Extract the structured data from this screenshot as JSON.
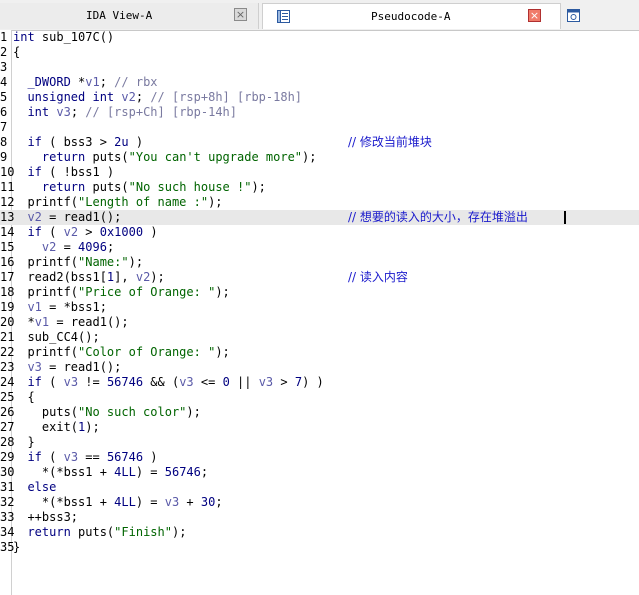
{
  "tabs": {
    "ida_view": {
      "label": "IDA View-A",
      "close_glyph": "×"
    },
    "pseudocode": {
      "label": "Pseudocode-A",
      "close_glyph": "×"
    }
  },
  "lines": [
    {
      "ln": "1",
      "code": "int sub_107C()"
    },
    {
      "ln": "2",
      "code": "{"
    },
    {
      "ln": "3",
      "code": ""
    },
    {
      "ln": "4",
      "code": "  _DWORD *v1; // rbx"
    },
    {
      "ln": "5",
      "code": "  unsigned int v2; // [rsp+8h] [rbp-18h]"
    },
    {
      "ln": "6",
      "code": "  int v3; // [rsp+Ch] [rbp-14h]"
    },
    {
      "ln": "7",
      "code": ""
    },
    {
      "ln": "8",
      "code": "  if ( bss3 > 2u )",
      "comment": "// 修改当前堆块"
    },
    {
      "ln": "9",
      "code": "    return puts(\"You can't upgrade more\");"
    },
    {
      "ln": "10",
      "code": "  if ( !bss1 )"
    },
    {
      "ln": "11",
      "code": "    return puts(\"No such house !\");"
    },
    {
      "ln": "12",
      "code": "  printf(\"Length of name :\");"
    },
    {
      "ln": "13",
      "code": "  v2 = read1();",
      "comment": "// 想要的读入的大小，存在堆溢出",
      "highlight": true
    },
    {
      "ln": "14",
      "code": "  if ( v2 > 0x1000 )"
    },
    {
      "ln": "15",
      "code": "    v2 = 4096;"
    },
    {
      "ln": "16",
      "code": "  printf(\"Name:\");"
    },
    {
      "ln": "17",
      "code": "  read2(bss1[1], v2);",
      "comment": "// 读入内容"
    },
    {
      "ln": "18",
      "code": "  printf(\"Price of Orange: \");"
    },
    {
      "ln": "19",
      "code": "  v1 = *bss1;"
    },
    {
      "ln": "20",
      "code": "  *v1 = read1();"
    },
    {
      "ln": "21",
      "code": "  sub_CC4();"
    },
    {
      "ln": "22",
      "code": "  printf(\"Color of Orange: \");"
    },
    {
      "ln": "23",
      "code": "  v3 = read1();"
    },
    {
      "ln": "24",
      "code": "  if ( v3 != 56746 && (v3 <= 0 || v3 > 7) )"
    },
    {
      "ln": "25",
      "code": "  {"
    },
    {
      "ln": "26",
      "code": "    puts(\"No such color\");"
    },
    {
      "ln": "27",
      "code": "    exit(1);"
    },
    {
      "ln": "28",
      "code": "  }"
    },
    {
      "ln": "29",
      "code": "  if ( v3 == 56746 )"
    },
    {
      "ln": "30",
      "code": "    *(*bss1 + 4LL) = 56746;"
    },
    {
      "ln": "31",
      "code": "  else"
    },
    {
      "ln": "32",
      "code": "    *(*bss1 + 4LL) = v3 + 30;"
    },
    {
      "ln": "33",
      "code": "  ++bss3;"
    },
    {
      "ln": "34",
      "code": "  return puts(\"Finish\");"
    },
    {
      "ln": "35",
      "code": "}"
    }
  ],
  "colors": {
    "keyword": "#000080",
    "string": "#006400",
    "comment": "#1a1acc",
    "variable": "#5a5aa8",
    "highlight_line": "#e8e8e8"
  }
}
